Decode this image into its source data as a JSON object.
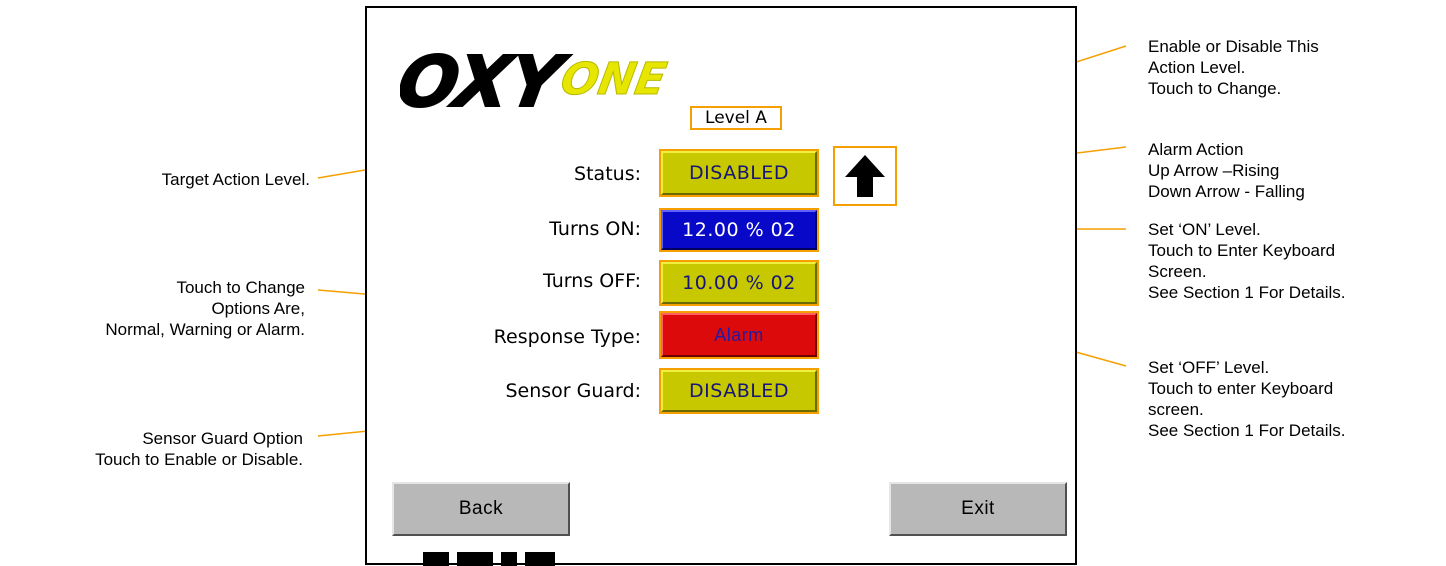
{
  "logo": {
    "part1": "OXY",
    "part2": "ONE"
  },
  "level_badge": "Level A",
  "form": {
    "status": {
      "label": "Status:",
      "value": "DISABLED"
    },
    "turns_on": {
      "label": "Turns ON:",
      "value": "12.00 % 02"
    },
    "turns_off": {
      "label": "Turns OFF:",
      "value": "10.00 % 02"
    },
    "response_type": {
      "label": "Response Type:",
      "value": "Alarm"
    },
    "sensor_guard": {
      "label": "Sensor Guard:",
      "value": "DISABLED"
    }
  },
  "alarm_direction_icon": "up-arrow-icon",
  "buttons": {
    "back": "Back",
    "exit": "Exit"
  },
  "callouts": {
    "target_action_level": "Target Action Level.",
    "touch_to_change": "Touch to Change\nOptions Are,\nNormal, Warning or Alarm.",
    "sensor_guard_option": "Sensor Guard Option\nTouch to Enable or Disable.",
    "enable_disable": "Enable or Disable This\nAction Level.\nTouch to Change.",
    "alarm_action": "Alarm Action\nUp Arrow –Rising\nDown Arrow - Falling",
    "set_on_level": "Set ‘ON’ Level.\nTouch to Enter Keyboard\nScreen.\nSee Section 1 For Details.",
    "set_off_level": "Set ‘OFF’ Level.\nTouch to enter Keyboard\nscreen.\nSee Section 1 For Details."
  },
  "colors": {
    "callout_line": "#f5a000",
    "yellow_button": "#c8c800",
    "blue_button": "#0808c8",
    "red_button": "#dc0a0a",
    "gray_button": "#b8b8b8",
    "logo_black": "#000000",
    "logo_yellow": "#e6e600"
  }
}
